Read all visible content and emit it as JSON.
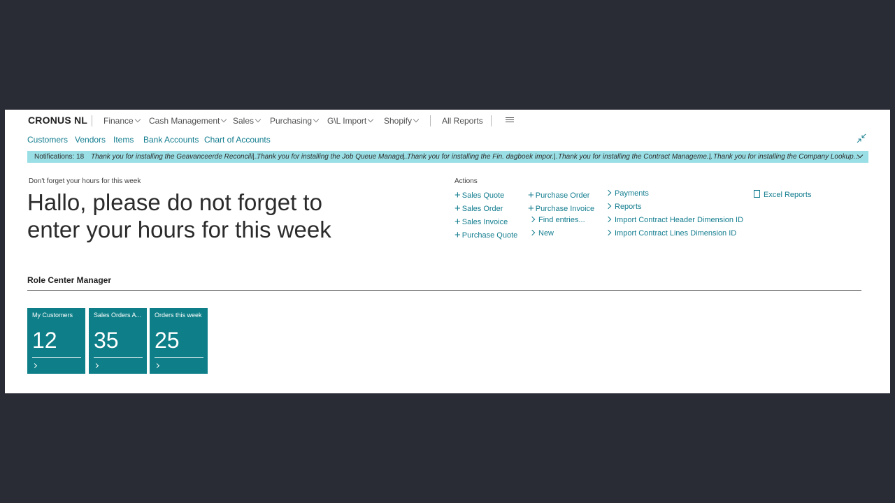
{
  "company": "CRONUS NL",
  "topnav": {
    "menus": [
      "Finance",
      "Cash Management",
      "Sales",
      "Purchasing",
      "G\\L Import",
      "Shopify"
    ],
    "all_reports": "All Reports"
  },
  "quicklinks": [
    "Customers",
    "Vendors",
    "Items",
    "Bank Accounts",
    "Chart of Accounts"
  ],
  "notifications": {
    "label": "Notifications: 18",
    "messages": [
      "Thank you for installing the Geavanceerde Reconcili...",
      "Thank you for installing the Job Queue Manage...",
      "Thank you for installing the Fin. dagboek impor...",
      "Thank you for installing the Contract Manageme...",
      "Thank you for installing the Company Lookup..."
    ],
    "separator": "|"
  },
  "headline": {
    "caption": "Don't forget your hours for this week",
    "text": "Hallo, please do not forget to enter your hours for this week"
  },
  "actions": {
    "title": "Actions",
    "col1": [
      "Sales Quote",
      "Sales Order",
      "Sales Invoice",
      "Purchase Quote"
    ],
    "col2": [
      "Purchase Order",
      "Purchase Invoice",
      "Find entries...",
      "New"
    ],
    "col3": [
      "Payments",
      "Reports",
      "Import Contract Header Dimension ID",
      "Import Contract Lines Dimension ID"
    ],
    "col4": [
      "Excel Reports"
    ]
  },
  "section": {
    "title": "Role Center Manager"
  },
  "tiles": [
    {
      "label": "My Customers",
      "value": "12"
    },
    {
      "label": "Sales Orders A...",
      "value": "35"
    },
    {
      "label": "Orders this week",
      "value": "25"
    }
  ],
  "colors": {
    "accent": "#137d8f",
    "tile": "#0e7f88",
    "notification_bar": "#9adfe5",
    "background": "#292c35"
  }
}
